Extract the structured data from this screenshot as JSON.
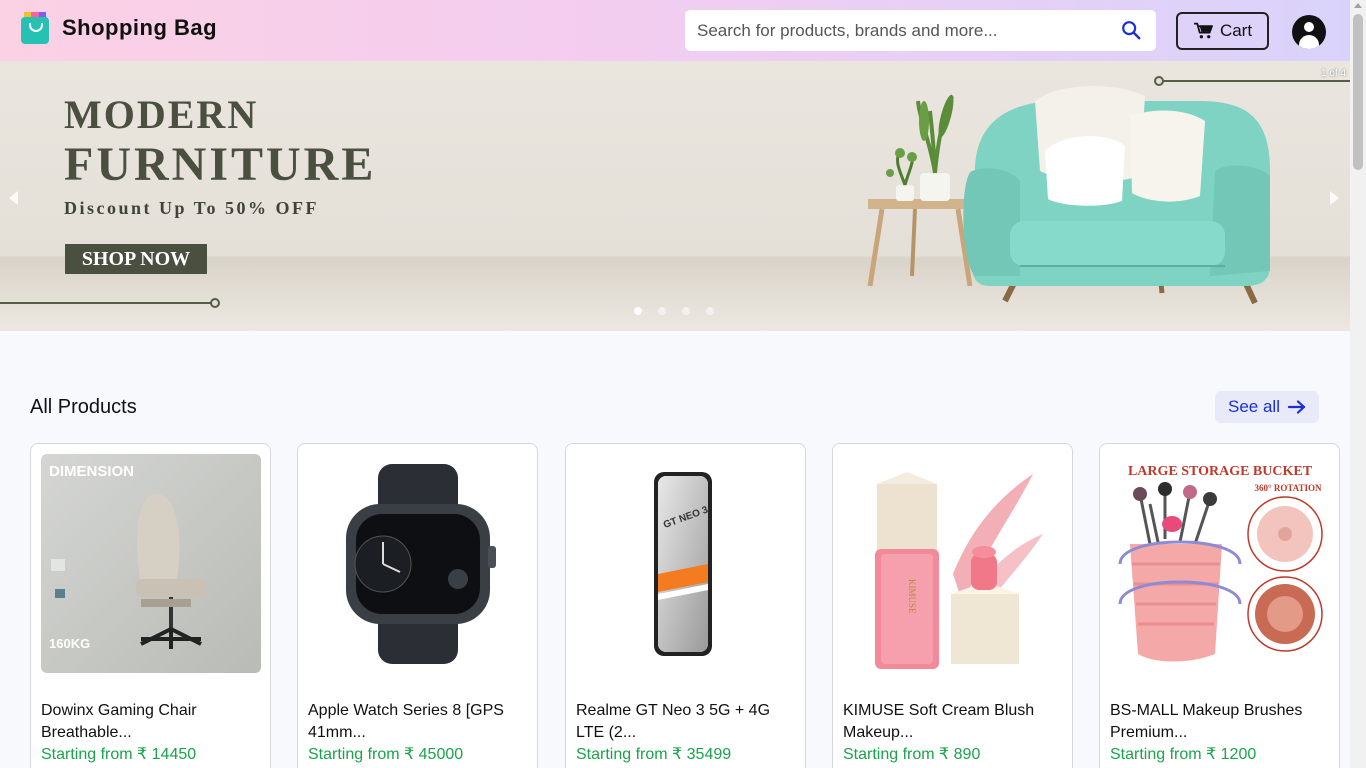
{
  "header": {
    "brand": "Shopping Bag",
    "search_placeholder": "Search for products, brands and more...",
    "cart_label": "Cart"
  },
  "banner": {
    "title_line1": "MODERN",
    "title_line2": "FURNITURE",
    "subtitle": "Discount Up To 50% OFF",
    "cta": "SHOP NOW",
    "counter": "1 of 4",
    "slide_count": 4,
    "active_slide": 1
  },
  "section": {
    "title": "All Products",
    "see_all": "See all"
  },
  "products": [
    {
      "name": "Dowinx Gaming Chair Breathable...",
      "price": "Starting from ₹ 14450",
      "image_text": "DIMENSION",
      "image_badge": "160KG"
    },
    {
      "name": "Apple Watch Series 8 [GPS 41mm...",
      "price": "Starting from ₹ 45000"
    },
    {
      "name": "Realme GT Neo 3 5G + 4G LTE (2...",
      "price": "Starting from ₹ 35499",
      "image_text": "GT NEO 3"
    },
    {
      "name": "KIMUSE Soft Cream Blush Makeup...",
      "price": "Starting from ₹ 890",
      "image_text": "KIMUSE"
    },
    {
      "name": "BS-MALL Makeup Brushes Premium...",
      "price": "Starting from ₹ 1200",
      "image_text": "LARGE STORAGE BUCKET",
      "image_subtext": "360° ROTATION"
    }
  ],
  "colors": {
    "accent": "#1a2fd6",
    "price_green": "#1aa34a",
    "banner_dark": "#4a4f40",
    "chair_teal": "#7fd3c3"
  },
  "icons": [
    "search-icon",
    "cart-icon",
    "user-avatar-icon",
    "arrow-right-icon",
    "chevron-left-icon",
    "chevron-right-icon"
  ]
}
